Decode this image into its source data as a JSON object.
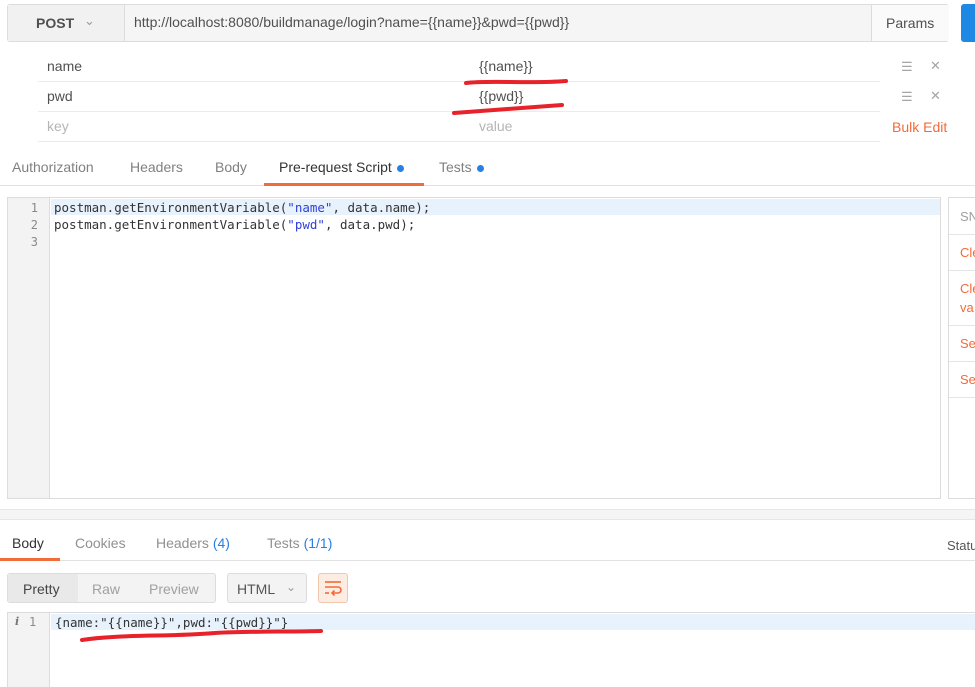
{
  "request": {
    "method": "POST",
    "url": "http://localhost:8080/buildmanage/login?name={{name}}&pwd={{pwd}}",
    "params_label": "Params"
  },
  "params": {
    "rows": [
      {
        "key": "name",
        "value": "{{name}}"
      },
      {
        "key": "pwd",
        "value": "{{pwd}}"
      }
    ],
    "placeholder_key": "key",
    "placeholder_value": "value",
    "bulk_edit_label": "Bulk Edit"
  },
  "request_tabs": [
    {
      "label": "Authorization"
    },
    {
      "label": "Headers"
    },
    {
      "label": "Body"
    },
    {
      "label": "Pre-request Script",
      "active": true
    },
    {
      "label": "Tests"
    }
  ],
  "script": {
    "line_numbers": [
      "1",
      "2",
      "3"
    ],
    "lines": [
      {
        "pre": "postman.getEnvironmentVariable(",
        "str": "\"name\"",
        "post": ", data.name);"
      },
      {
        "pre": "postman.getEnvironmentVariable(",
        "str": "\"pwd\"",
        "post": ", data.pwd);"
      },
      {
        "pre": "",
        "str": "",
        "post": ""
      }
    ]
  },
  "snippets": {
    "title": "SN",
    "items": [
      "Cle",
      "Cle",
      "va",
      "Se",
      "Se"
    ]
  },
  "response_tabs": {
    "body": "Body",
    "cookies": "Cookies",
    "headers": "Headers",
    "headers_count": "(4)",
    "tests": "Tests",
    "tests_count": "(1/1)",
    "status": "Statu"
  },
  "response_toolbar": {
    "modes": [
      "Pretty",
      "Raw",
      "Preview"
    ],
    "format": "HTML"
  },
  "response_body": {
    "info_icon": "i",
    "line_number": "1",
    "line": "{name:\"{{name}}\",pwd:\"{{pwd}}\"}"
  },
  "colors": {
    "accent": "#f26b3a",
    "link": "#2a7fe2",
    "send": "#1e88e5",
    "annotation": "#e8222a"
  }
}
